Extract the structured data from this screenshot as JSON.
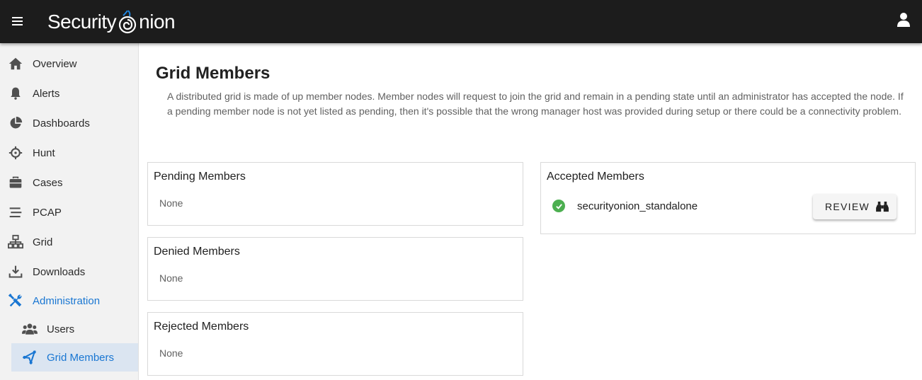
{
  "header": {
    "logo_left": "Security",
    "logo_right": "nion"
  },
  "sidebar": {
    "items": [
      {
        "label": "Overview",
        "icon": "home-icon"
      },
      {
        "label": "Alerts",
        "icon": "bell-icon"
      },
      {
        "label": "Dashboards",
        "icon": "pie-chart-icon"
      },
      {
        "label": "Hunt",
        "icon": "crosshairs-icon"
      },
      {
        "label": "Cases",
        "icon": "briefcase-icon"
      },
      {
        "label": "PCAP",
        "icon": "stream-icon"
      },
      {
        "label": "Grid",
        "icon": "network-icon"
      },
      {
        "label": "Downloads",
        "icon": "download-icon"
      },
      {
        "label": "Administration",
        "icon": "tools-icon"
      }
    ],
    "sub_items": [
      {
        "label": "Users",
        "icon": "users-icon"
      },
      {
        "label": "Grid Members",
        "icon": "grid-members-icon"
      }
    ],
    "active_color": "#1976d2"
  },
  "main": {
    "title": "Grid Members",
    "description": "A distributed grid is made of up member nodes. Member nodes will request to join the grid and remain in a pending state until an administrator has accepted the node. If a pending member node is not yet listed as pending, then it's possible that the wrong manager host was provided during setup or there could be a connectivity problem.",
    "pending": {
      "title": "Pending Members",
      "empty": "None"
    },
    "denied": {
      "title": "Denied Members",
      "empty": "None"
    },
    "rejected": {
      "title": "Rejected Members",
      "empty": "None"
    },
    "accepted": {
      "title": "Accepted Members",
      "members": [
        {
          "name": "securityonion_standalone",
          "status": "accepted",
          "status_color": "#4caf50",
          "button": "REVIEW",
          "button_icon": "binoculars-icon"
        }
      ]
    }
  }
}
